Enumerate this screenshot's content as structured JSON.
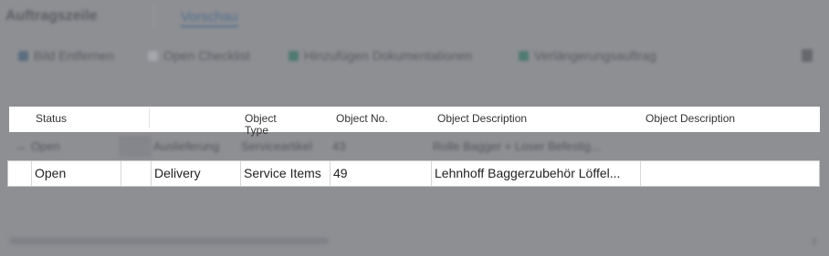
{
  "background": {
    "title": "Auftragszeile",
    "tab": "Vorschau",
    "actions": [
      {
        "label": "Bild Entfernen",
        "icon": "edit-icon"
      },
      {
        "label": "Open Checklist",
        "icon": "checklist-icon"
      },
      {
        "label": "Hinzufügen Dokumentationen",
        "icon": "add-document-icon"
      },
      {
        "label": "Verlängerungsauftrag",
        "icon": "extend-icon"
      }
    ],
    "row": {
      "status": "Open",
      "type": "Auslieferung",
      "object_type": "Serviceartikel",
      "object_no": "43",
      "description": "Rolle Bagger + Loser Befestig..."
    }
  },
  "table": {
    "columns": {
      "status": "Status",
      "object_type": "Object Type",
      "object_no": "Object No.",
      "description_1": "Object Description",
      "description_2": "Object Description"
    },
    "selected_row": {
      "status": "Open",
      "type": "Delivery",
      "object_type": "Service Items",
      "object_no": "49",
      "description": "Lehnhoff Baggerzubehör Löffel..."
    }
  },
  "colors": {
    "overlay": "#8e8f93",
    "row_background": "#ffffff",
    "tab_accent": "#4f6f8f"
  }
}
